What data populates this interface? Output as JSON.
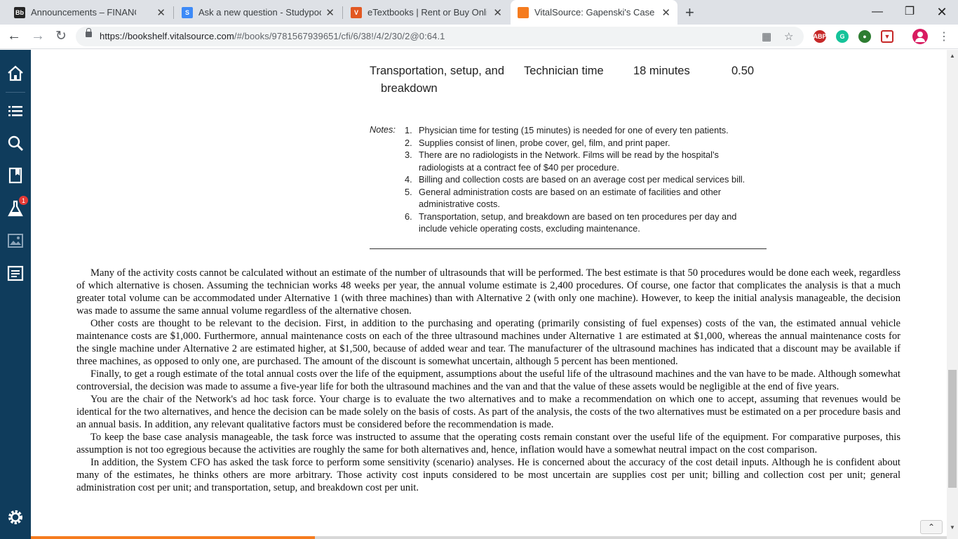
{
  "browser": {
    "tabs": [
      {
        "title": "Announcements – FINANCING AI",
        "icon": "blackboard-icon",
        "icon_text": "Bb",
        "color": "#262626",
        "active": false
      },
      {
        "title": "Ask a new question - Studypool",
        "icon": "studypool-icon",
        "icon_text": "S",
        "color": "#3d8af7",
        "active": false
      },
      {
        "title": "eTextbooks | Rent or Buy Online",
        "icon": "vitalsource-icon",
        "icon_text": "V",
        "color": "#e25822",
        "active": false
      },
      {
        "title": "VitalSource: Gapenski's Cases in",
        "icon": "bookshelf-icon",
        "icon_text": "",
        "color": "#f57c1f",
        "active": true
      }
    ],
    "url_host": "https://bookshelf.vitalsource.com",
    "url_path": "/#/books/9781567939651/cfi/6/38!/4/2/30/2@0:64.1"
  },
  "reader": {
    "table_row": {
      "activity_line1": "Transportation, setup, and",
      "activity_line2": "breakdown",
      "driver": "Technician time",
      "time": "18 minutes",
      "cost": "0.50"
    },
    "notes_label": "Notes:",
    "notes": [
      {
        "num": "1.",
        "text": "Physician time for testing (15 minutes) is needed for one of every ten patients."
      },
      {
        "num": "2.",
        "text": "Supplies consist of linen, probe cover, gel, film, and print paper."
      },
      {
        "num": "3.",
        "text": "There are no radiologists in the Network. Films will be read by the hospital’s radiologists at a contract fee of $40 per procedure."
      },
      {
        "num": "4.",
        "text": "Billing and collection costs are based on an average cost per medical services bill."
      },
      {
        "num": "5.",
        "text": "General administration costs are based on an estimate of facilities and other administrative costs."
      },
      {
        "num": "6.",
        "text": "Transportation, setup, and breakdown are based on ten procedures per day and include vehicle operating costs, excluding maintenance."
      }
    ],
    "paragraphs": [
      "Many of the activity costs cannot be calculated without an estimate of the number of ultrasounds that will be performed. The best estimate is that 50 procedures would be done each week, regardless of which alternative is chosen. Assuming the technician works 48 weeks per year, the annual volume estimate is 2,400 procedures. Of course, one factor that complicates the analysis is that a much greater total volume can be accommodated under Alternative 1 (with three machines) than with Alternative 2 (with only one machine). However, to keep the initial analysis manageable, the decision was made to assume the same annual volume regardless of the alternative chosen.",
      "Other costs are thought to be relevant to the decision. First, in addition to the purchasing and operating (primarily consisting of fuel expenses) costs of the van, the estimated annual vehicle maintenance costs are $1,000. Furthermore, annual maintenance costs on each of the three ultrasound machines under Alternative 1 are estimated at $1,000, whereas the annual maintenance costs for the single machine under Alternative 2 are estimated higher, at $1,500, because of added wear and tear. The manufacturer of the ultrasound machines has indicated that a discount may be available if three machines, as opposed to only one, are purchased. The amount of the discount is somewhat uncertain, although 5 percent has been mentioned.",
      "Finally, to get a rough estimate of the total annual costs over the life of the equipment, assumptions about the useful life of the ultrasound machines and the van have to be made. Although somewhat controversial, the decision was made to assume a five-year life for both the ultrasound machines and the van and that the value of these assets would be negligible at the end of five years.",
      "You are the chair of the Network's ad hoc task force. Your charge is to evaluate the two alternatives and to make a recommendation on which one to accept, assuming that revenues would be identical for the two alternatives, and hence the decision can be made solely on the basis of costs. As part of the analysis, the costs of the two alternatives must be estimated on a per procedure basis and an annual basis. In addition, any relevant qualitative factors must be considered before the recommendation is made.",
      "To keep the base case analysis manageable, the task force was instructed to assume that the operating costs remain constant over the useful life of the equipment. For comparative purposes, this assumption is not too egregious because the activities are roughly the same for both alternatives and, hence, inflation would have a somewhat neutral impact on the cost comparison.",
      "In addition, the System CFO has asked the task force to perform some sensitivity (scenario) analyses. He is concerned about the accuracy of the cost detail inputs. Although he is confident about many of the estimates, he thinks others are more arbitrary. Those activity cost inputs considered to be most uncertain are supplies cost per unit; billing and collection cost per unit; general administration cost per unit; and transportation, setup, and breakdown cost per unit."
    ],
    "workbook_badge": "1",
    "reading_progress": 0.31
  },
  "colors": {
    "sidebar": "#0f3c5c",
    "progress": "#f57c1f",
    "accent_badge": "#e53935"
  }
}
